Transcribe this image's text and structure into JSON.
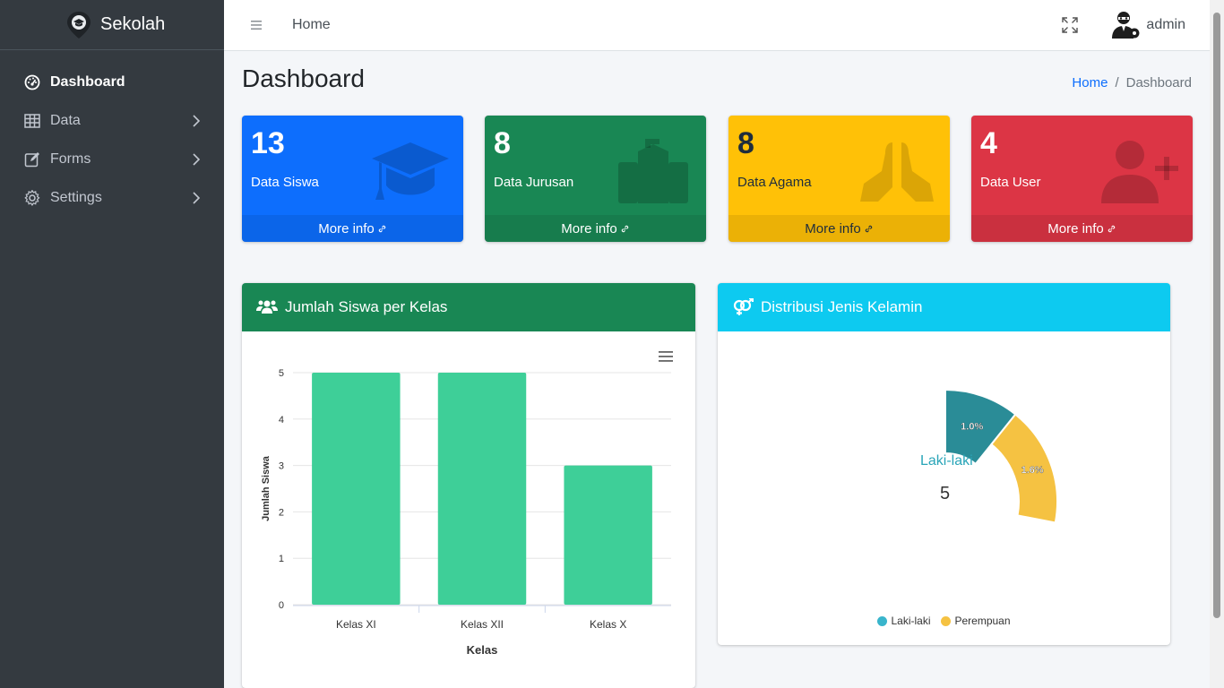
{
  "app": {
    "brand": "Sekolah",
    "username": "admin"
  },
  "sidebar": {
    "items": [
      {
        "label": "Dashboard",
        "icon": "gauge-icon",
        "active": true
      },
      {
        "label": "Data",
        "icon": "table-icon"
      },
      {
        "label": "Forms",
        "icon": "edit-icon"
      },
      {
        "label": "Settings",
        "icon": "gear-icon"
      }
    ]
  },
  "topbar": {
    "home": "Home"
  },
  "page": {
    "title": "Dashboard"
  },
  "breadcrumb": {
    "home": "Home",
    "separator": "/",
    "current": "Dashboard"
  },
  "stats": [
    {
      "number": "13",
      "label": "Data Siswa",
      "more": "More info",
      "icon": "graduation-cap-icon",
      "color": "#0d6efd"
    },
    {
      "number": "8",
      "label": "Data Jurusan",
      "more": "More info",
      "icon": "school-icon",
      "color": "#198754"
    },
    {
      "number": "8",
      "label": "Data Agama",
      "more": "More info",
      "icon": "praying-hands-icon",
      "color": "#ffc107"
    },
    {
      "number": "4",
      "label": "Data User",
      "more": "More info",
      "icon": "user-plus-icon",
      "color": "#dc3545"
    }
  ],
  "cards": {
    "bar": {
      "title": "Jumlah Siswa per Kelas"
    },
    "pie": {
      "title": "Distribusi Jenis Kelamin",
      "hover_label": "Laki-laki",
      "hover_value": "5"
    }
  },
  "chart_data": [
    {
      "type": "bar",
      "categories": [
        "Kelas XI",
        "Kelas XII",
        "Kelas X"
      ],
      "values": [
        5,
        5,
        3
      ],
      "xlabel": "Kelas",
      "ylabel": "Jumlah Siswa",
      "ylim": [
        0,
        5
      ],
      "yticks": [
        "0",
        "1",
        "2",
        "3",
        "4",
        "5"
      ],
      "color": "#3ecf98",
      "grid": true
    },
    {
      "type": "pie",
      "categories": [
        "Laki-laki",
        "Perempuan"
      ],
      "values": [
        5,
        8
      ],
      "data_labels": [
        "1.0%",
        "1.6%"
      ],
      "colors": [
        "#2a8c97",
        "#f5c242"
      ],
      "legend": "bottom"
    }
  ]
}
